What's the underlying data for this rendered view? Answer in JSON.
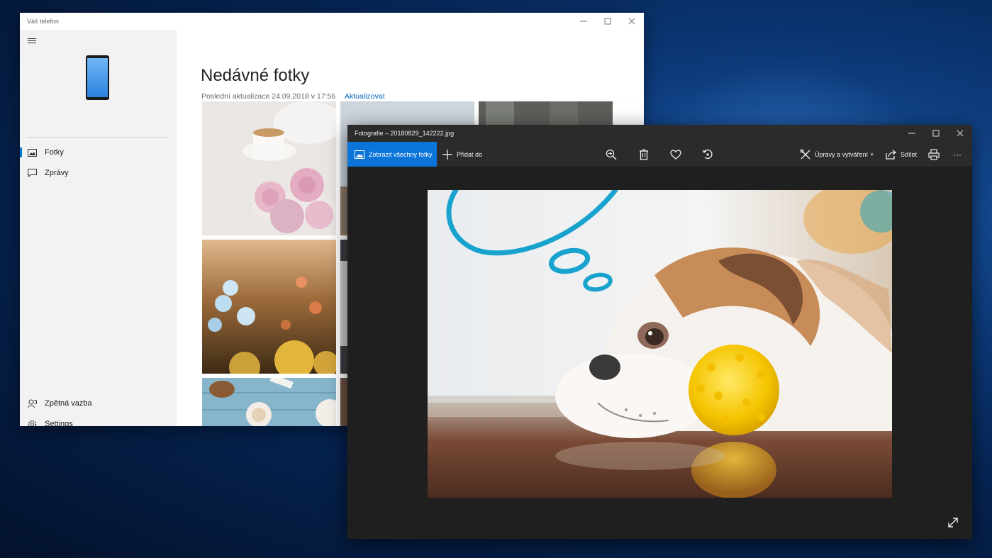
{
  "phone_app": {
    "window_title": "Váš telefon",
    "nav": [
      {
        "label": "Fotky",
        "icon": "photos-icon",
        "active": true
      },
      {
        "label": "Zprávy",
        "icon": "chat-icon",
        "active": false
      }
    ],
    "bottom_nav": [
      {
        "label": "Zpětná vazba",
        "icon": "feedback-icon"
      },
      {
        "label": "Settings",
        "icon": "gear-icon"
      }
    ],
    "page_title": "Nedávné fotky",
    "last_update": "Poslední aktualizace 24.09.2018 v 17:56",
    "refresh_link": "Aktualizovat"
  },
  "photos_app": {
    "window_title": "Fotografie – 20180829_142222.jpg",
    "toolbar": {
      "show_all": "Zobrazit všechny fotky",
      "add_to": "Přidat do",
      "edit_create": "Úpravy a vytváření",
      "share": "Sdílet",
      "more": "···"
    },
    "icons": [
      "zoom-icon",
      "delete-icon",
      "heart-icon",
      "rotate-icon",
      "print-icon",
      "expand-icon"
    ]
  },
  "colors": {
    "accent": "#0a74d8",
    "link": "#0067c0",
    "sidebar_bg": "#f2f2f2",
    "viewer_bg": "#1f1f1f"
  }
}
